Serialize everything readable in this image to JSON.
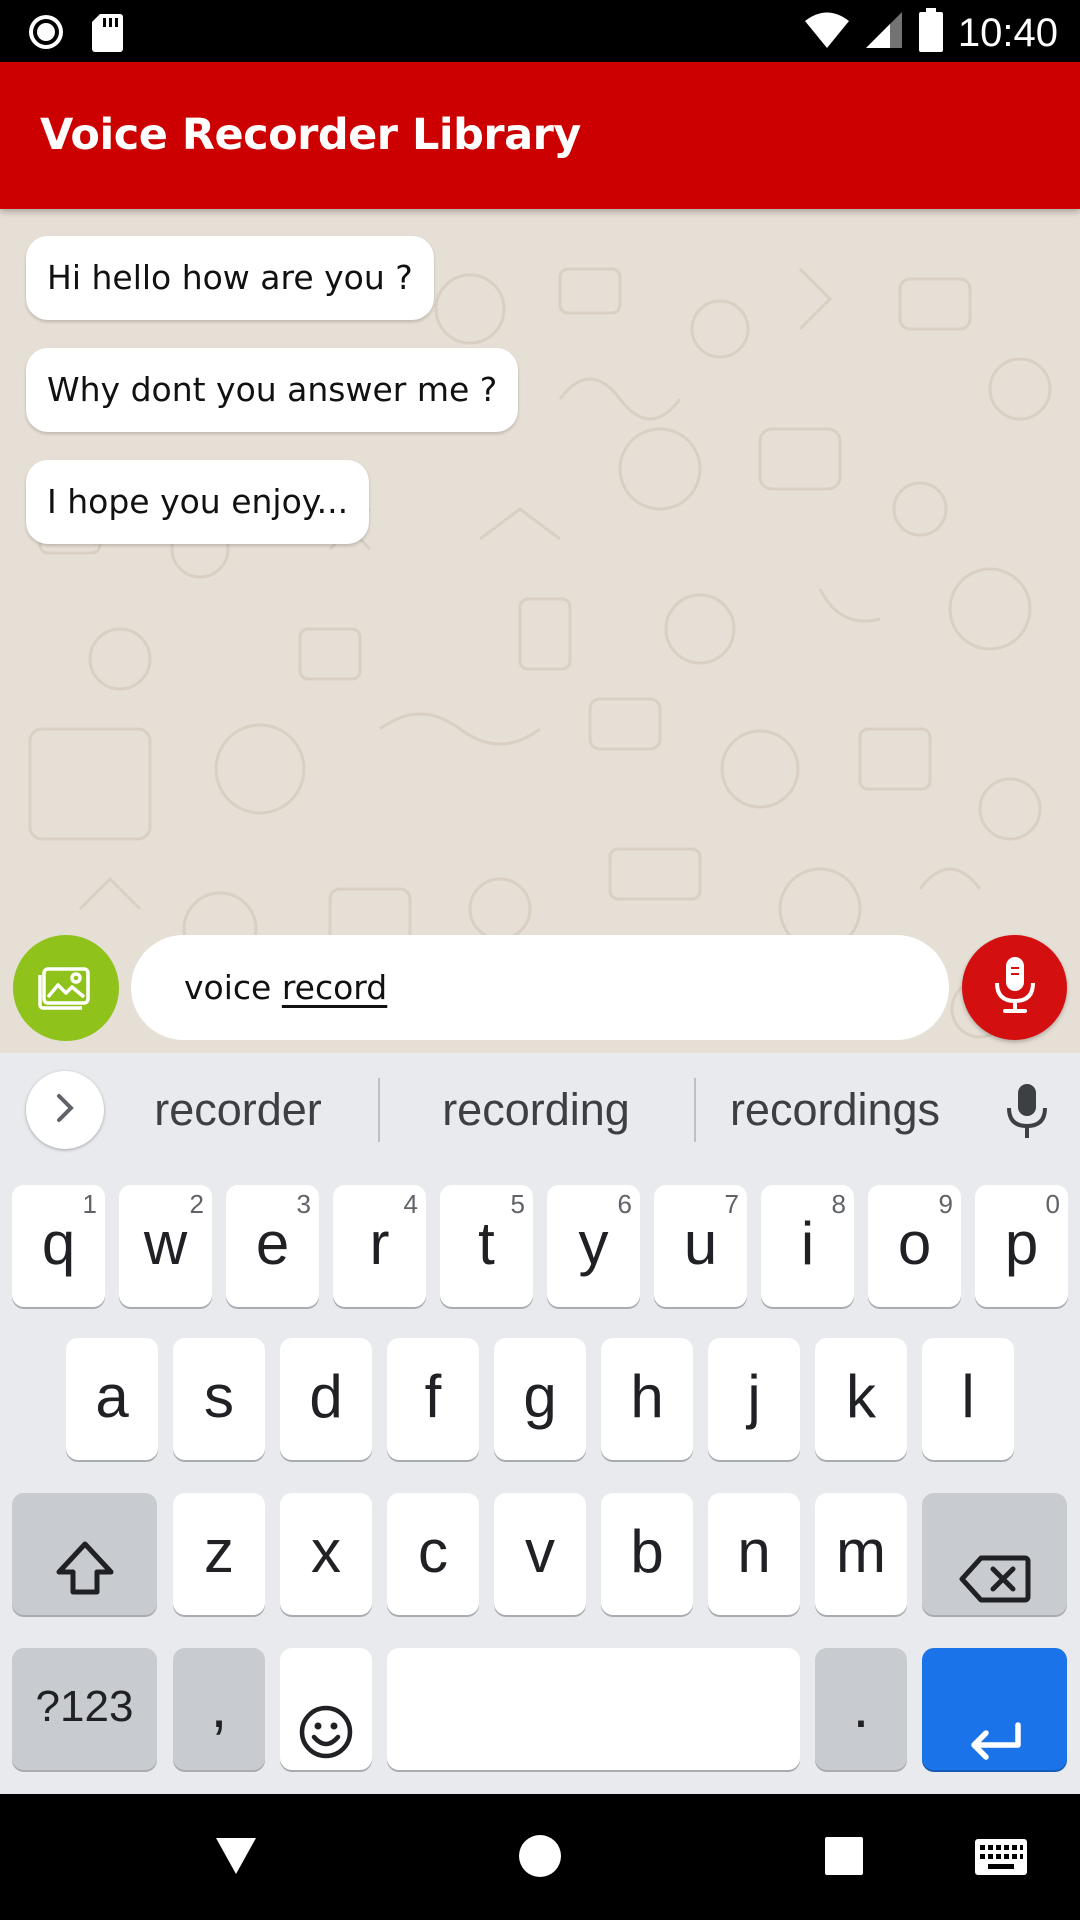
{
  "status_bar": {
    "time": "10:40",
    "left_icons": [
      "record-icon",
      "sd-card-icon"
    ],
    "right_icons": [
      "wifi-icon",
      "signal-icon",
      "battery-icon"
    ]
  },
  "app_bar": {
    "title": "Voice Recorder Library",
    "color": "#cc0000"
  },
  "chat": {
    "background": "#e6dfd5",
    "messages": [
      {
        "text": "Hi hello how are you ?"
      },
      {
        "text": "Why dont you answer me ?"
      },
      {
        "text": "I hope you enjoy..."
      }
    ]
  },
  "composer": {
    "gallery_icon": "gallery-icon",
    "gallery_color": "#8fc21a",
    "input_text_committed": "voice ",
    "input_text_composing": "record",
    "mic_icon": "microphone-icon",
    "mic_color": "#d40f0f"
  },
  "keyboard": {
    "suggestions": [
      "recorder",
      "recording",
      "recordings"
    ],
    "rows": [
      [
        {
          "k": "q",
          "h": "1"
        },
        {
          "k": "w",
          "h": "2"
        },
        {
          "k": "e",
          "h": "3"
        },
        {
          "k": "r",
          "h": "4"
        },
        {
          "k": "t",
          "h": "5"
        },
        {
          "k": "y",
          "h": "6"
        },
        {
          "k": "u",
          "h": "7"
        },
        {
          "k": "i",
          "h": "8"
        },
        {
          "k": "o",
          "h": "9"
        },
        {
          "k": "p",
          "h": "0"
        }
      ],
      [
        {
          "k": "a"
        },
        {
          "k": "s"
        },
        {
          "k": "d"
        },
        {
          "k": "f"
        },
        {
          "k": "g"
        },
        {
          "k": "h"
        },
        {
          "k": "j"
        },
        {
          "k": "k"
        },
        {
          "k": "l"
        }
      ],
      [
        {
          "k": "z"
        },
        {
          "k": "x"
        },
        {
          "k": "c"
        },
        {
          "k": "v"
        },
        {
          "k": "b"
        },
        {
          "k": "n"
        },
        {
          "k": "m"
        }
      ]
    ],
    "symbols_label": "?123",
    "comma_label": ",",
    "period_label": ".",
    "enter_color": "#1a73e8"
  },
  "nav_bar": {
    "icons": [
      "back-icon",
      "home-icon",
      "recents-icon",
      "keyboard-icon"
    ]
  }
}
